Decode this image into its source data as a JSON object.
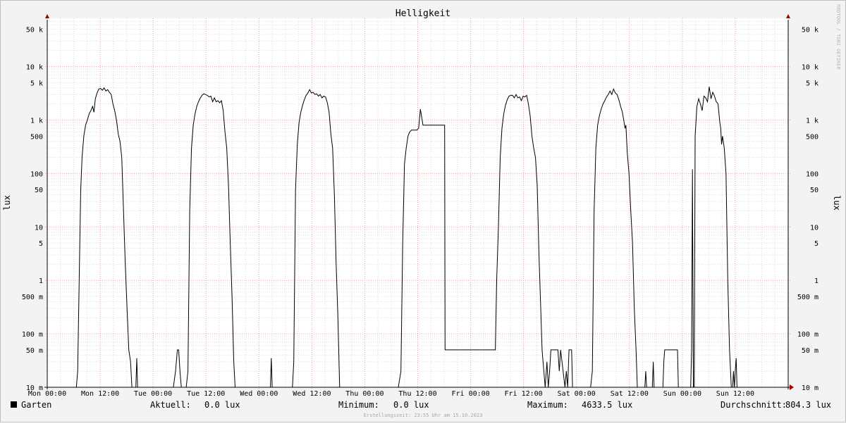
{
  "chart_data": {
    "type": "line",
    "title": "Helligkeit",
    "ylabel": "lux",
    "y_scale": "log",
    "ylim": [
      0.01,
      80000
    ],
    "xlim": [
      0,
      168
    ],
    "grid": true,
    "legend_position": "bottom-left",
    "watermark": "RRDTOOL / TOBI OETIKER",
    "footer": "Erstellungszeit: 23:55 Uhr am 15.10.2023",
    "x_ticks": [
      {
        "x": 0,
        "label": "Mon 00:00"
      },
      {
        "x": 12,
        "label": "Mon 12:00"
      },
      {
        "x": 24,
        "label": "Tue 00:00"
      },
      {
        "x": 36,
        "label": "Tue 12:00"
      },
      {
        "x": 48,
        "label": "Wed 00:00"
      },
      {
        "x": 60,
        "label": "Wed 12:00"
      },
      {
        "x": 72,
        "label": "Thu 00:00"
      },
      {
        "x": 84,
        "label": "Thu 12:00"
      },
      {
        "x": 96,
        "label": "Fri 00:00"
      },
      {
        "x": 108,
        "label": "Fri 12:00"
      },
      {
        "x": 120,
        "label": "Sat 00:00"
      },
      {
        "x": 132,
        "label": "Sat 12:00"
      },
      {
        "x": 144,
        "label": "Sun 00:00"
      },
      {
        "x": 156,
        "label": "Sun 12:00"
      }
    ],
    "y_ticks": [
      {
        "y": 0.01,
        "label": "10 m"
      },
      {
        "y": 0.05,
        "label": "50 m"
      },
      {
        "y": 0.1,
        "label": "100 m"
      },
      {
        "y": 0.5,
        "label": "500 m"
      },
      {
        "y": 1,
        "label": "1"
      },
      {
        "y": 5,
        "label": "5"
      },
      {
        "y": 10,
        "label": "10"
      },
      {
        "y": 50,
        "label": "50"
      },
      {
        "y": 100,
        "label": "100"
      },
      {
        "y": 500,
        "label": "500"
      },
      {
        "y": 1000,
        "label": "1 k"
      },
      {
        "y": 5000,
        "label": "5 k"
      },
      {
        "y": 10000,
        "label": "10 k"
      },
      {
        "y": 50000,
        "label": "50 k"
      }
    ],
    "series": [
      {
        "name": "Garten",
        "color": "#000000",
        "points": [
          [
            0,
            0.01
          ],
          [
            6.6,
            0.01
          ],
          [
            6.9,
            0.02
          ],
          [
            7.3,
            2
          ],
          [
            7.6,
            50
          ],
          [
            7.9,
            200
          ],
          [
            8.3,
            500
          ],
          [
            8.7,
            800
          ],
          [
            9.1,
            1000
          ],
          [
            9.5,
            1300
          ],
          [
            9.9,
            1500
          ],
          [
            10.3,
            1800
          ],
          [
            10.6,
            1400
          ],
          [
            10.9,
            2500
          ],
          [
            11.3,
            3200
          ],
          [
            11.7,
            3800
          ],
          [
            12.1,
            3900
          ],
          [
            12.5,
            3600
          ],
          [
            12.9,
            4000
          ],
          [
            13.3,
            3500
          ],
          [
            13.7,
            3700
          ],
          [
            14.1,
            3300
          ],
          [
            14.5,
            3000
          ],
          [
            14.9,
            2000
          ],
          [
            15.3,
            1500
          ],
          [
            15.7,
            1000
          ],
          [
            16.1,
            550
          ],
          [
            16.5,
            400
          ],
          [
            16.9,
            200
          ],
          [
            17.3,
            20
          ],
          [
            17.7,
            2
          ],
          [
            18.1,
            0.3
          ],
          [
            18.5,
            0.05
          ],
          [
            18.9,
            0.03
          ],
          [
            19.2,
            0.01
          ],
          [
            20.1,
            0.01
          ],
          [
            20.3,
            0.035
          ],
          [
            20.5,
            0.01
          ],
          [
            28.6,
            0.01
          ],
          [
            29.1,
            0.02
          ],
          [
            29.5,
            0.05
          ],
          [
            29.8,
            0.05
          ],
          [
            30.1,
            0.02
          ],
          [
            30.4,
            0.01
          ],
          [
            31.5,
            0.01
          ],
          [
            31.9,
            0.02
          ],
          [
            32.3,
            20
          ],
          [
            32.7,
            300
          ],
          [
            33.1,
            800
          ],
          [
            33.5,
            1300
          ],
          [
            33.9,
            1800
          ],
          [
            34.3,
            2200
          ],
          [
            34.7,
            2600
          ],
          [
            35.1,
            2900
          ],
          [
            35.5,
            3100
          ],
          [
            35.9,
            3000
          ],
          [
            36.3,
            2900
          ],
          [
            36.7,
            2700
          ],
          [
            37.1,
            2800
          ],
          [
            37.5,
            2200
          ],
          [
            37.9,
            2600
          ],
          [
            38.3,
            2200
          ],
          [
            38.7,
            2300
          ],
          [
            39.1,
            2100
          ],
          [
            39.5,
            2300
          ],
          [
            39.9,
            1500
          ],
          [
            40.3,
            600
          ],
          [
            40.7,
            300
          ],
          [
            41.1,
            60
          ],
          [
            41.5,
            5
          ],
          [
            41.9,
            0.5
          ],
          [
            42.3,
            0.03
          ],
          [
            42.6,
            0.01
          ],
          [
            50.6,
            0.01
          ],
          [
            50.8,
            0.035
          ],
          [
            51,
            0.01
          ],
          [
            55.6,
            0.01
          ],
          [
            55.9,
            0.03
          ],
          [
            56.3,
            50
          ],
          [
            56.7,
            350
          ],
          [
            57.1,
            900
          ],
          [
            57.5,
            1400
          ],
          [
            57.9,
            1900
          ],
          [
            58.3,
            2400
          ],
          [
            58.7,
            2900
          ],
          [
            59.1,
            3200
          ],
          [
            59.5,
            3700
          ],
          [
            59.9,
            3200
          ],
          [
            60.3,
            3300
          ],
          [
            60.7,
            3000
          ],
          [
            61.1,
            3100
          ],
          [
            61.5,
            2800
          ],
          [
            61.9,
            3000
          ],
          [
            62.3,
            2600
          ],
          [
            62.7,
            2800
          ],
          [
            63.1,
            2700
          ],
          [
            63.5,
            2100
          ],
          [
            63.9,
            1400
          ],
          [
            64.3,
            550
          ],
          [
            64.7,
            300
          ],
          [
            65.1,
            40
          ],
          [
            65.5,
            2
          ],
          [
            65.9,
            0.2
          ],
          [
            66.3,
            0.01
          ],
          [
            79.6,
            0.01
          ],
          [
            80.2,
            0.02
          ],
          [
            80.6,
            5
          ],
          [
            81.0,
            150
          ],
          [
            81.4,
            300
          ],
          [
            81.8,
            500
          ],
          [
            82.2,
            600
          ],
          [
            82.6,
            650
          ],
          [
            83.0,
            650
          ],
          [
            83.4,
            650
          ],
          [
            83.8,
            650
          ],
          [
            84.2,
            700
          ],
          [
            84.6,
            1600
          ],
          [
            85.0,
            1000
          ],
          [
            85.2,
            800
          ],
          [
            89.8,
            800
          ],
          [
            90.1,
            800
          ],
          [
            90.2,
            0.05
          ],
          [
            101.6,
            0.05
          ],
          [
            101.9,
            1
          ],
          [
            102.3,
            10
          ],
          [
            102.7,
            200
          ],
          [
            103.1,
            700
          ],
          [
            103.5,
            1300
          ],
          [
            103.9,
            1900
          ],
          [
            104.3,
            2400
          ],
          [
            104.7,
            2800
          ],
          [
            105.1,
            2900
          ],
          [
            105.5,
            2900
          ],
          [
            105.9,
            2600
          ],
          [
            106.3,
            3000
          ],
          [
            106.7,
            2600
          ],
          [
            107.1,
            2700
          ],
          [
            107.5,
            2300
          ],
          [
            107.9,
            2800
          ],
          [
            108.3,
            2700
          ],
          [
            108.7,
            2900
          ],
          [
            109.1,
            2000
          ],
          [
            109.5,
            1200
          ],
          [
            109.9,
            500
          ],
          [
            110.3,
            300
          ],
          [
            110.7,
            200
          ],
          [
            111.1,
            60
          ],
          [
            111.5,
            3
          ],
          [
            111.9,
            0.3
          ],
          [
            112.2,
            0.05
          ],
          [
            112.6,
            0.02
          ],
          [
            112.9,
            0.01
          ],
          [
            113.3,
            0.03
          ],
          [
            113.6,
            0.01
          ],
          [
            113.9,
            0.02
          ],
          [
            114.2,
            0.05
          ],
          [
            115.8,
            0.05
          ],
          [
            116.1,
            0.02
          ],
          [
            116.4,
            0.05
          ],
          [
            117.4,
            0.01
          ],
          [
            117.7,
            0.02
          ],
          [
            118.0,
            0.01
          ],
          [
            118.3,
            0.05
          ],
          [
            118.9,
            0.05
          ],
          [
            119.1,
            0.01
          ],
          [
            123.2,
            0.01
          ],
          [
            123.6,
            0.02
          ],
          [
            124.0,
            20
          ],
          [
            124.4,
            300
          ],
          [
            124.8,
            800
          ],
          [
            125.2,
            1200
          ],
          [
            125.6,
            1600
          ],
          [
            126.0,
            2000
          ],
          [
            126.4,
            2300
          ],
          [
            126.8,
            2700
          ],
          [
            127.2,
            3000
          ],
          [
            127.6,
            3500
          ],
          [
            128.0,
            3000
          ],
          [
            128.4,
            3800
          ],
          [
            128.8,
            3200
          ],
          [
            129.2,
            3000
          ],
          [
            129.6,
            2400
          ],
          [
            130.0,
            1800
          ],
          [
            130.4,
            1400
          ],
          [
            130.8,
            900
          ],
          [
            131.0,
            700
          ],
          [
            131.2,
            800
          ],
          [
            131.5,
            250
          ],
          [
            131.9,
            100
          ],
          [
            132.3,
            20
          ],
          [
            132.7,
            5
          ],
          [
            133.1,
            0.3
          ],
          [
            133.5,
            0.05
          ],
          [
            133.8,
            0.01
          ],
          [
            135.5,
            0.01
          ],
          [
            135.7,
            0.02
          ],
          [
            135.9,
            0.01
          ],
          [
            137.2,
            0.01
          ],
          [
            137.4,
            0.03
          ],
          [
            137.6,
            0.01
          ],
          [
            139.6,
            0.01
          ],
          [
            139.8,
            0.03
          ],
          [
            140.0,
            0.05
          ],
          [
            142.9,
            0.05
          ],
          [
            143.1,
            0.01
          ],
          [
            145.9,
            0.01
          ],
          [
            146.1,
            0.05
          ],
          [
            146.3,
            120
          ],
          [
            146.5,
            0.01
          ],
          [
            146.7,
            0.01
          ],
          [
            146.9,
            500
          ],
          [
            147.3,
            1800
          ],
          [
            147.7,
            2500
          ],
          [
            148.1,
            2000
          ],
          [
            148.5,
            1500
          ],
          [
            148.9,
            2800
          ],
          [
            149.3,
            2600
          ],
          [
            149.7,
            2200
          ],
          [
            150.1,
            4200
          ],
          [
            150.5,
            2500
          ],
          [
            150.9,
            3300
          ],
          [
            151.3,
            2800
          ],
          [
            151.7,
            2200
          ],
          [
            152.1,
            2000
          ],
          [
            152.5,
            900
          ],
          [
            152.7,
            700
          ],
          [
            152.9,
            350
          ],
          [
            153.1,
            500
          ],
          [
            153.5,
            300
          ],
          [
            153.9,
            100
          ],
          [
            154.3,
            1
          ],
          [
            154.7,
            0.05
          ],
          [
            155.1,
            0.01
          ],
          [
            155.4,
            0.01
          ],
          [
            155.6,
            0.02
          ],
          [
            155.8,
            0.01
          ],
          [
            156.0,
            0.02
          ],
          [
            156.2,
            0.035
          ],
          [
            156.4,
            0.01
          ],
          [
            168,
            0.01
          ]
        ]
      }
    ]
  },
  "stats": {
    "current_label": "Aktuell:",
    "current_value": "0.0 lux",
    "min_label": "Minimum:",
    "min_value": "0.0 lux",
    "max_label": "Maximum:",
    "max_value": "4633.5 lux",
    "avg_label": "Durchschnitt:",
    "avg_value": "804.3 lux"
  }
}
